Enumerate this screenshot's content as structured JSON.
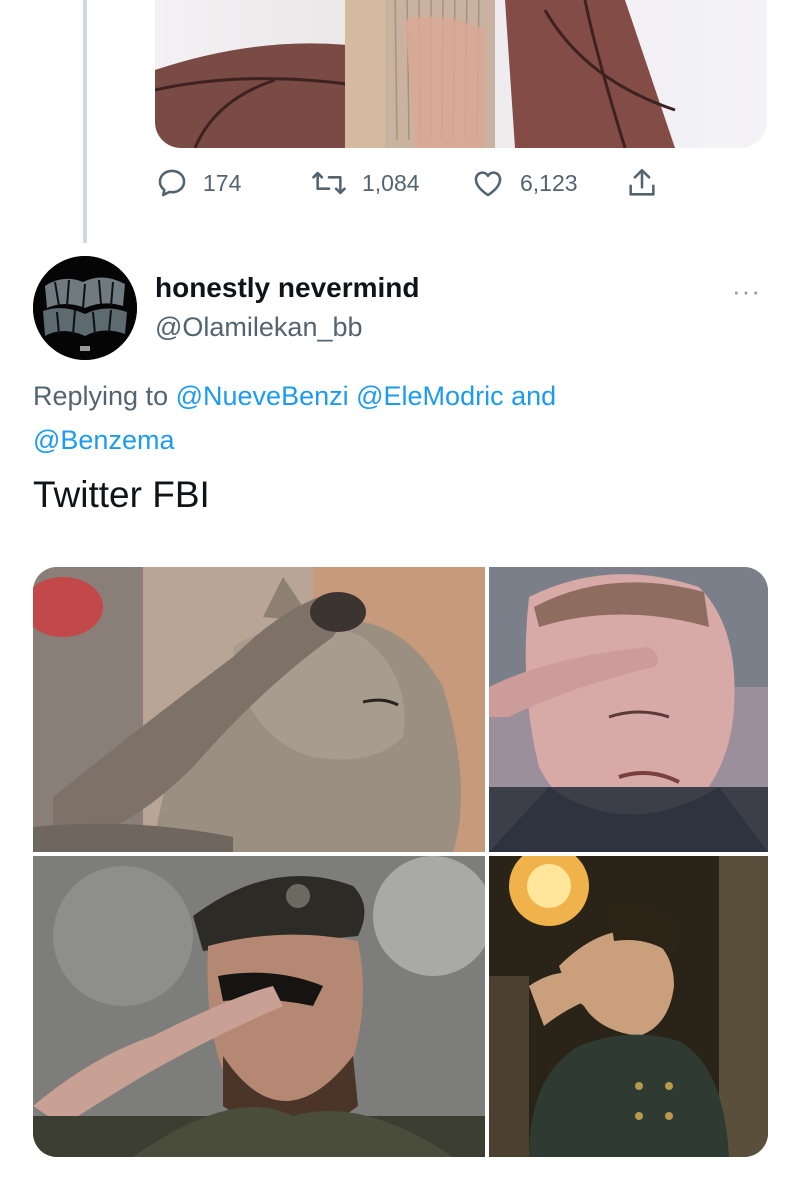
{
  "previous_tweet": {
    "stats": {
      "replies": "174",
      "retweets": "1,084",
      "likes": "6,123"
    }
  },
  "tweet": {
    "author_name": "honestly nevermind",
    "author_handle": "@Olamilekan_bb",
    "more_label": "···",
    "reply_prefix": "Replying to",
    "reply_mentions": [
      "@NueveBenzi",
      "@EleModric",
      "@Benzema"
    ],
    "reply_conjunction": "and",
    "text": "Twitter FBI"
  },
  "media": [
    {
      "description": "cat-saluting"
    },
    {
      "description": "crying-man-saluting"
    },
    {
      "description": "soldier-with-eyepatch-saluting"
    },
    {
      "description": "man-in-coat-saluting-at-night"
    }
  ],
  "colors": {
    "link": "#1d9bf0",
    "secondary_text": "#536471",
    "thread_line": "#cfd9de"
  }
}
